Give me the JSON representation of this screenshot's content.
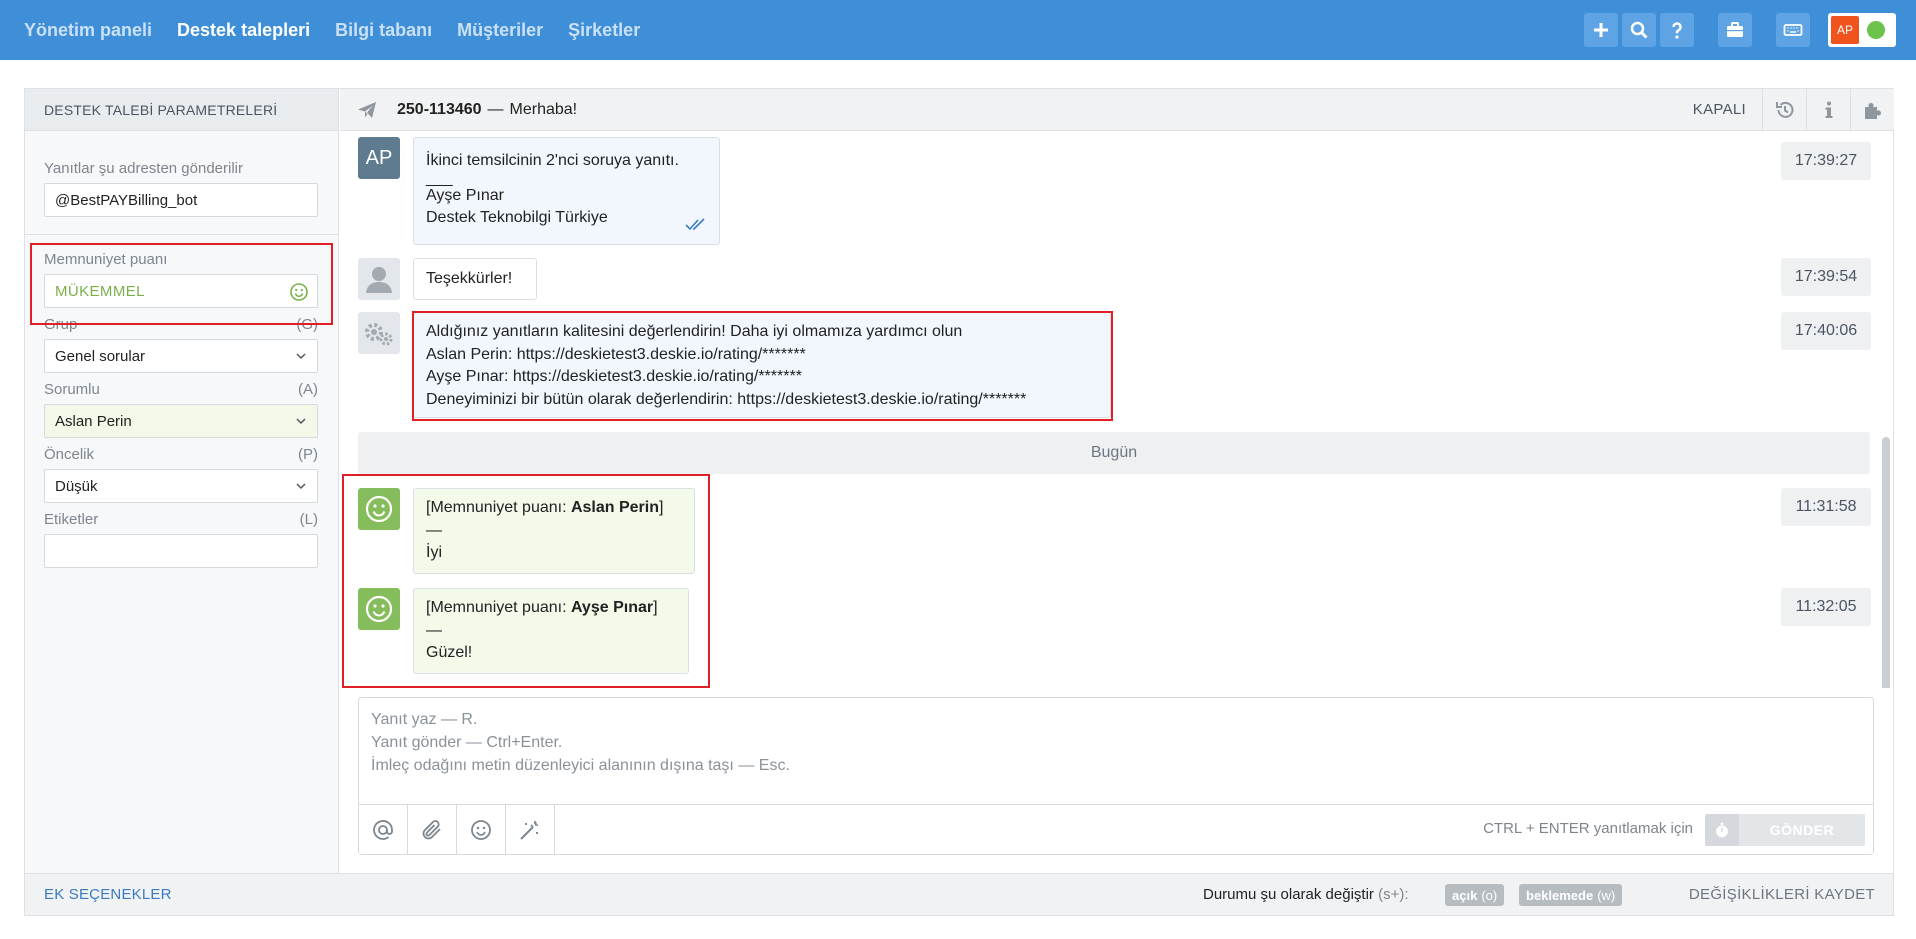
{
  "nav": {
    "items": [
      "Yönetim paneli",
      "Destek talepleri",
      "Bilgi tabanı",
      "Müşteriler",
      "Şirketler"
    ],
    "active": "Destek talepleri"
  },
  "top_icons": [
    "plus-icon",
    "search-icon",
    "help-icon",
    "briefcase-icon",
    "keyboard-icon"
  ],
  "user": {
    "initials": "AP",
    "status_color": "#6cc24a",
    "avatar_color": "#f0531d"
  },
  "sidebar": {
    "header": "DESTEK TALEBİ PARAMETRELERİ",
    "reply_from_label": "Yanıtlar şu adresten gönderilir",
    "reply_from_value": "@BestPAYBilling_bot",
    "satisfaction_label": "Memnuniyet puanı",
    "satisfaction_value": "MÜKEMMEL",
    "group_label": "Grup",
    "group_key": "(G)",
    "group_value": "Genel sorular",
    "assignee_label": "Sorumlu",
    "assignee_key": "(A)",
    "assignee_value": "Aslan Perin",
    "priority_label": "Öncelik",
    "priority_key": "(P)",
    "priority_value": "Düşük",
    "tags_label": "Etiketler",
    "tags_key": "(L)",
    "tags_value": ""
  },
  "ticket": {
    "number": "250-113460",
    "dash": "—",
    "subject": "Merhaba!",
    "status": "KAPALI"
  },
  "messages": [
    {
      "avatar": "AP",
      "lines": [
        "İkinci temsilcinin 2'nci soruya yanıtı.",
        "___",
        "Ayşe Pınar",
        "Destek Teknobilgi Türkiye"
      ],
      "time": "17:39:27"
    },
    {
      "lines": [
        "Teşekkürler!"
      ],
      "time": "17:39:54"
    },
    {
      "lines": [
        "Aldığınız yanıtların kalitesini değerlendirin! Daha iyi olmamıza yardımcı olun",
        "Aslan Perin: https://deskietest3.deskie.io/rating/*******",
        "Ayşe Pınar: https://deskietest3.deskie.io/rating/*******",
        "Deneyiminizi bir bütün olarak değerlendirin: https://deskietest3.deskie.io/rating/*******"
      ],
      "time": "17:40:06"
    },
    {
      "prefix": "[Memnuniyet puanı: ",
      "name": "Aslan Perin",
      "suffix": "]",
      "dash": "—",
      "rating": "İyi",
      "time": "11:31:58"
    },
    {
      "prefix": "[Memnuniyet puanı: ",
      "name": "Ayşe Pınar",
      "suffix": "]",
      "dash": "—",
      "rating": "Güzel!",
      "time": "11:32:05"
    }
  ],
  "today_label": "Bugün",
  "reply": {
    "placeholder_lines": [
      "Yanıt yaz — R.",
      "Yanıt gönder — Ctrl+Enter.",
      "İmleç odağını metin düzenleyici alanının dışına taşı — Esc."
    ],
    "hint": "CTRL + ENTER yanıtlamak için",
    "send": "GÖNDER"
  },
  "footer": {
    "more_options": "EK SEÇENEKLER",
    "change_status": "Durumu şu olarak değiştir",
    "change_status_key": "(s+):",
    "open_label": "açık",
    "open_key": "(o)",
    "pending_label": "beklemede",
    "pending_key": "(w)",
    "save": "DEĞİŞİKLİKLERİ KAYDET"
  },
  "colors": {
    "topbar": "#3f8fd8",
    "highlight_red": "#e01f26",
    "satisfaction_green": "#86bd5c"
  }
}
